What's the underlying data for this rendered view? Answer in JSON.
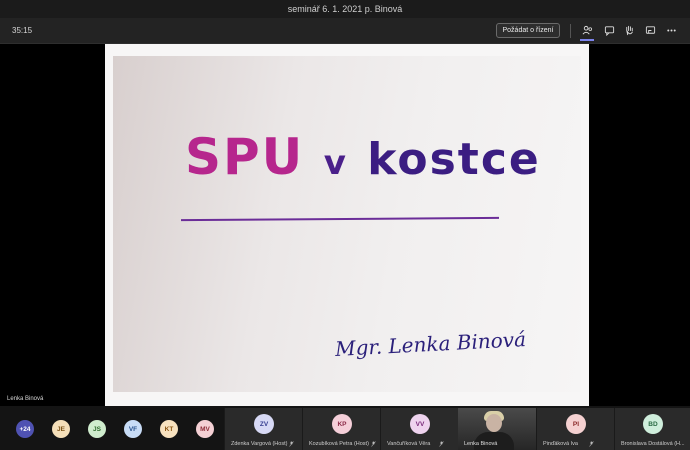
{
  "window": {
    "title": "seminář 6. 1. 2021 p. Binová"
  },
  "toolbar": {
    "timer": "35:15",
    "request_control_label": "Požádat o řízení",
    "icons": [
      "participants-icon",
      "chat-icon",
      "raise-hand-icon",
      "share-icon",
      "more-icon"
    ],
    "accent_color": "#7b83eb"
  },
  "slide": {
    "title_part1": "SPU",
    "title_part2": "v",
    "title_part3": "kostce",
    "author": "Mgr. Lenka Binová"
  },
  "stage": {
    "presenter_name": "Lenka Binová"
  },
  "participants": {
    "overflow": "+24",
    "small_avatars": [
      {
        "initials": "JE",
        "bg": "#f5dfb9",
        "fg": "#7a4f12"
      },
      {
        "initials": "JS",
        "bg": "#cfeccd",
        "fg": "#2c6a2a"
      },
      {
        "initials": "VF",
        "bg": "#c8dcf6",
        "fg": "#244f8c"
      },
      {
        "initials": "KT",
        "bg": "#f8e2bf",
        "fg": "#8a5410"
      },
      {
        "initials": "MV",
        "bg": "#f4d0d4",
        "fg": "#8c2a36"
      }
    ],
    "tiles": [
      {
        "initials": "ZV",
        "name": "Zdenka Vargová (Host)",
        "bg": "#d7d9f5",
        "fg": "#343c8f"
      },
      {
        "initials": "KP",
        "name": "Kozubíková Petra (Host)",
        "bg": "#f5cfd9",
        "fg": "#8a2a47"
      },
      {
        "initials": "VV",
        "name": "Vančuříková Věra",
        "bg": "#eed3ee",
        "fg": "#7a2a7a"
      },
      {
        "initials": "PI",
        "name": "Pinďáková Iva",
        "bg": "#f5d1d1",
        "fg": "#8a2a2a"
      },
      {
        "initials": "BD",
        "name": "Bronislava Dostálová (H...",
        "bg": "#cfeedc",
        "fg": "#2a6a44"
      }
    ],
    "video": {
      "name": "Lenka Binová"
    }
  }
}
